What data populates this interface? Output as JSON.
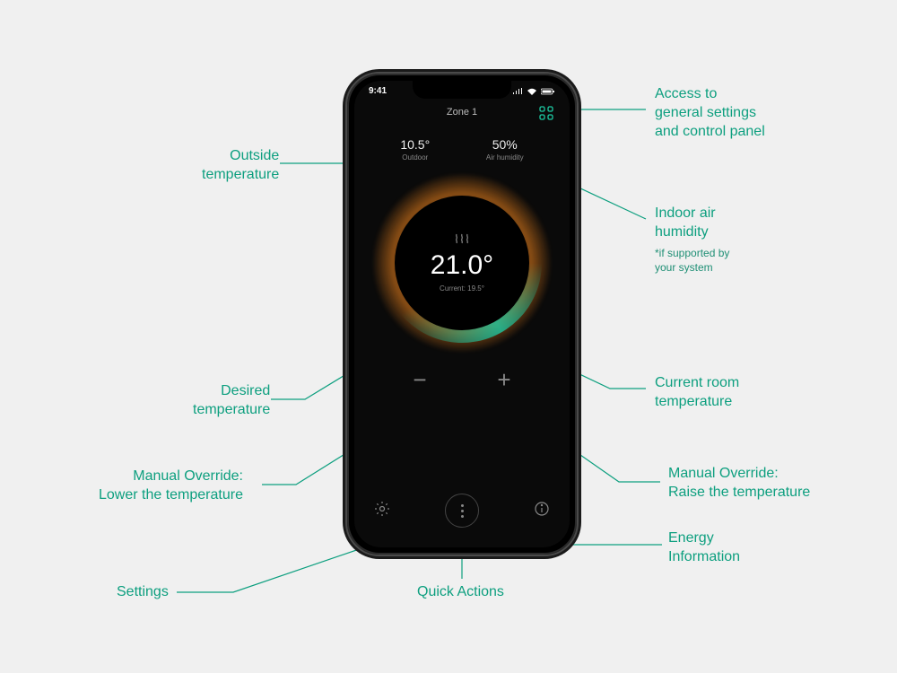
{
  "status": {
    "time": "9:41",
    "signal": "●●●",
    "wifi": "⌵",
    "battery": "▮"
  },
  "zone": "Zone 1",
  "outdoor": {
    "value": "10.5°",
    "label": "Outdoor"
  },
  "humidity": {
    "value": "50%",
    "label": "Air humidity"
  },
  "dial": {
    "heat_icon": "𝄞𝄞𝄞",
    "target": "21.0°",
    "current": "Current: 19.5°"
  },
  "adjust": {
    "minus": "−",
    "plus": "+"
  },
  "annotations": {
    "outside": "Outside\ntemperature",
    "desired": "Desired\ntemperature",
    "lower": "Manual Override:\nLower the temperature",
    "settings": "Settings",
    "quick": "Quick Actions",
    "panel": "Access to\ngeneral settings\nand control panel",
    "humidity": "Indoor air\nhumidity",
    "humidity_note": "*if supported by\nyour system",
    "current": "Current room\ntemperature",
    "raise": "Manual Override:\nRaise the temperature",
    "energy": "Energy\nInformation"
  }
}
